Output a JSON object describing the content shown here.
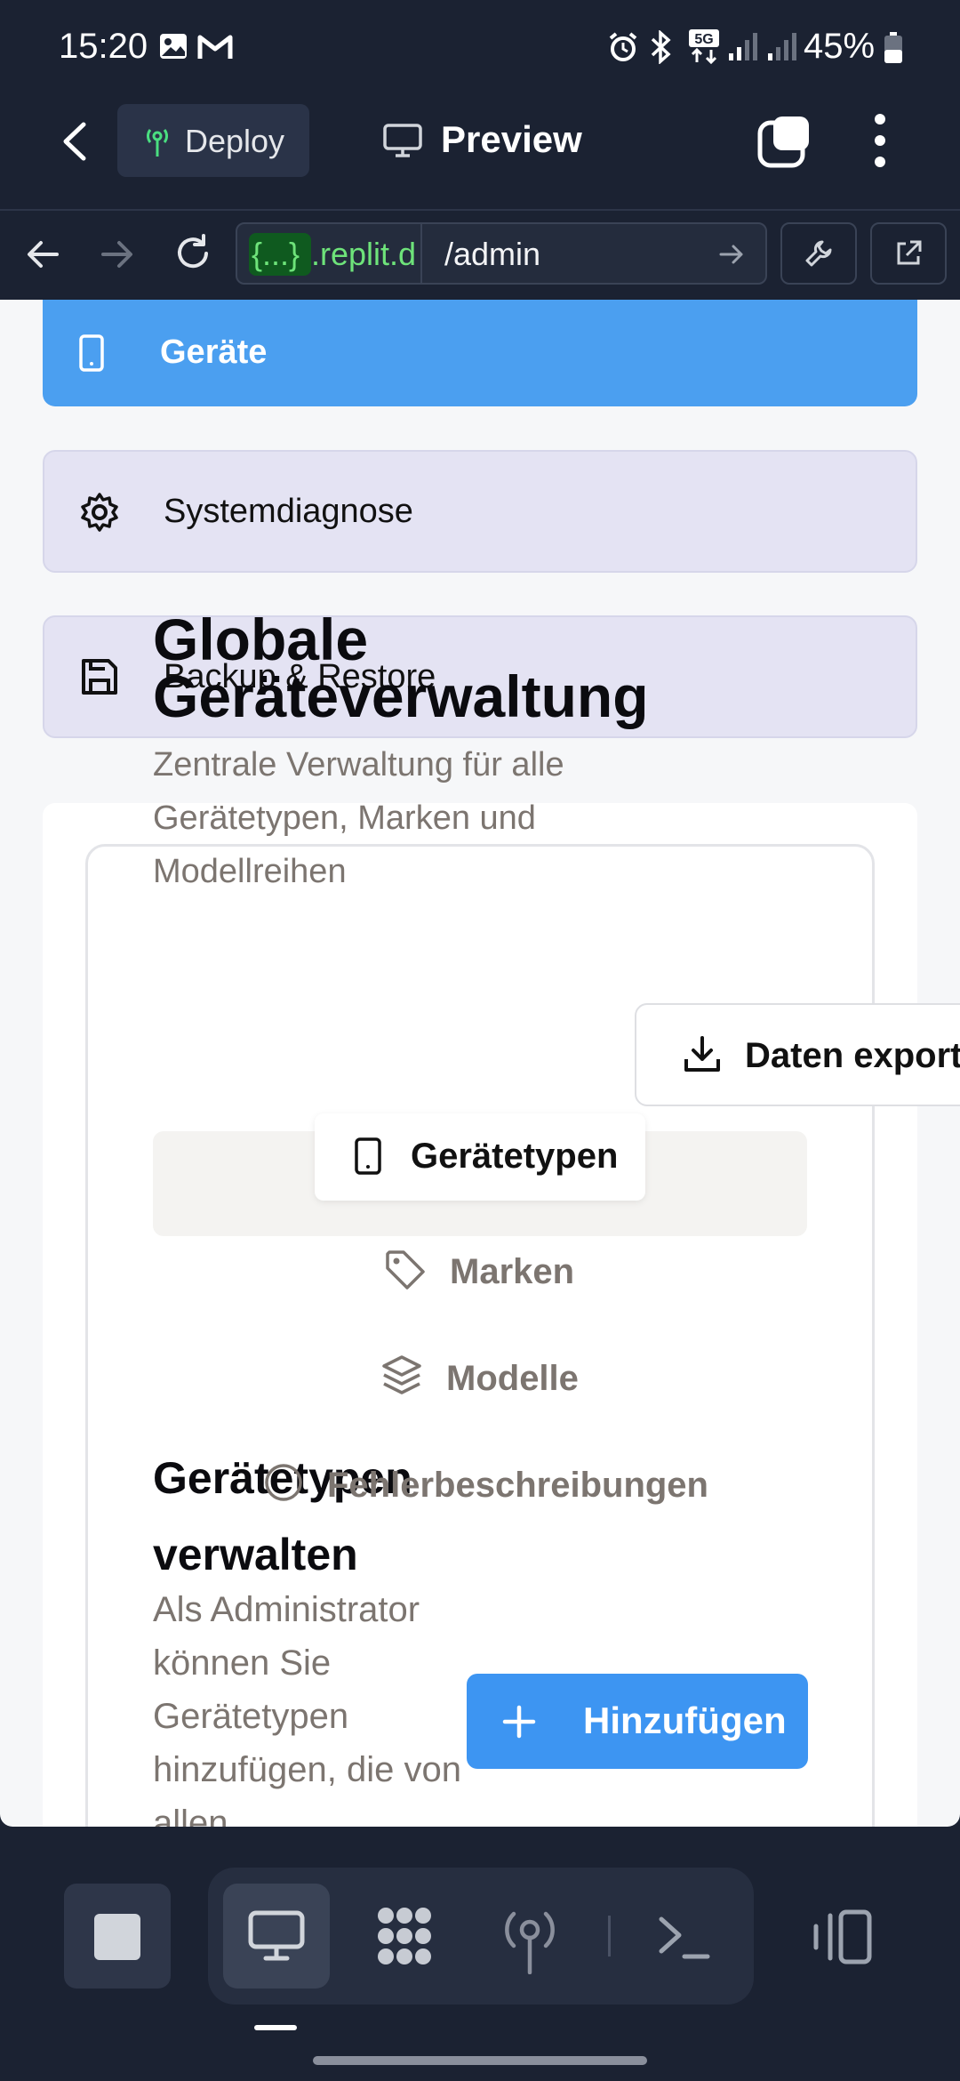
{
  "status_bar": {
    "time": "15:20",
    "battery": "45%",
    "icons": [
      "image-icon",
      "gmail-icon",
      "alarm-icon",
      "bluetooth-icon",
      "5g-icon",
      "signal-icon",
      "signal-icon",
      "battery-icon"
    ]
  },
  "top_bar": {
    "deploy_label": "Deploy",
    "preview_label": "Preview"
  },
  "url_bar": {
    "domain_token": "{...}",
    "domain_rest": ".replit.d",
    "path": "/admin"
  },
  "nav": {
    "items": [
      {
        "label": "Geräte",
        "icon": "smartphone-icon",
        "active": true
      },
      {
        "label": "Systemdiagnose",
        "icon": "gear-icon",
        "active": false
      },
      {
        "label": "Backup & Restore",
        "icon": "save-icon",
        "active": false
      }
    ]
  },
  "main": {
    "title": "Globale Geräteverwaltung",
    "description": "Zentrale Verwaltung für alle Gerätetypen, Marken und Modellreihen",
    "export_label": "Daten export",
    "tabs": [
      {
        "label": "Gerätetypen",
        "icon": "smartphone-icon",
        "active": true
      },
      {
        "label": "Marken",
        "icon": "tag-icon",
        "active": false
      },
      {
        "label": "Modelle",
        "icon": "layers-icon",
        "active": false
      },
      {
        "label": "Fehlerbeschreibungen",
        "icon": "alert-circle-icon",
        "active": false
      }
    ],
    "section": {
      "title": "Gerätetypen verwalten",
      "description": "Als Administrator können Sie Gerätetypen hinzufügen, die von allen",
      "add_label": "Hinzufügen"
    }
  },
  "colors": {
    "app_background": "#1b2232",
    "accent_blue": "#4b9ff0",
    "nav_item_bg": "#e4e3f3",
    "muted_text": "#7c7570"
  }
}
